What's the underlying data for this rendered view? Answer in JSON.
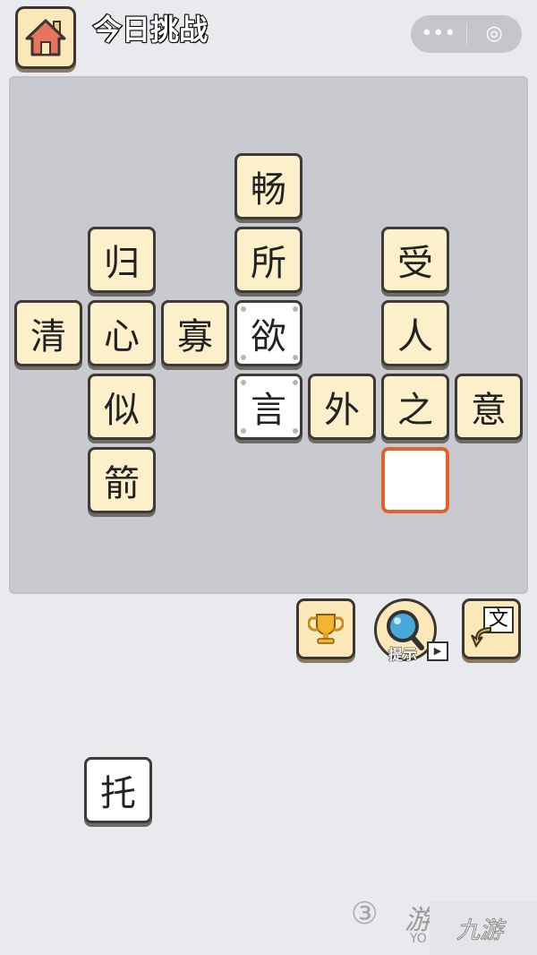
{
  "header": {
    "title": "今日挑战",
    "home_icon": "house-icon",
    "more_icon": "•••",
    "close_icon": "◎"
  },
  "board": {
    "tiles": [
      {
        "char": "畅",
        "row": 0,
        "col": 3,
        "style": "normal"
      },
      {
        "char": "归",
        "row": 1,
        "col": 1,
        "style": "normal"
      },
      {
        "char": "所",
        "row": 1,
        "col": 3,
        "style": "normal"
      },
      {
        "char": "受",
        "row": 1,
        "col": 5,
        "style": "normal"
      },
      {
        "char": "清",
        "row": 2,
        "col": 0,
        "style": "normal"
      },
      {
        "char": "心",
        "row": 2,
        "col": 1,
        "style": "normal"
      },
      {
        "char": "寡",
        "row": 2,
        "col": 2,
        "style": "normal"
      },
      {
        "char": "欲",
        "row": 2,
        "col": 3,
        "style": "fixed-white"
      },
      {
        "char": "人",
        "row": 2,
        "col": 5,
        "style": "normal"
      },
      {
        "char": "似",
        "row": 3,
        "col": 1,
        "style": "normal"
      },
      {
        "char": "言",
        "row": 3,
        "col": 3,
        "style": "fixed-white"
      },
      {
        "char": "外",
        "row": 3,
        "col": 4,
        "style": "normal"
      },
      {
        "char": "之",
        "row": 3,
        "col": 5,
        "style": "normal"
      },
      {
        "char": "意",
        "row": 3,
        "col": 6,
        "style": "normal"
      },
      {
        "char": "箭",
        "row": 4,
        "col": 1,
        "style": "normal"
      },
      {
        "char": "",
        "row": 4,
        "col": 5,
        "style": "empty-selected"
      }
    ]
  },
  "tools": {
    "hint_label": "提示",
    "switch_char": "文",
    "video_icon": "▶"
  },
  "options": [
    "托"
  ],
  "watermark": {
    "left": "游",
    "left_sub": "YO",
    "right": "九游"
  },
  "colors": {
    "tile": "#fbf0c9",
    "selected_border": "#e0622e",
    "board": "#c8cad0"
  }
}
